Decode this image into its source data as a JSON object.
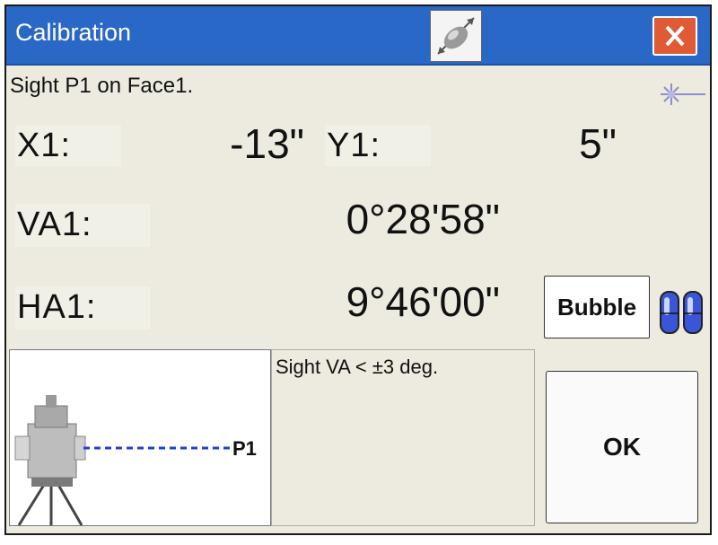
{
  "window": {
    "title": "Calibration"
  },
  "instruction": "Sight P1 on Face1.",
  "measurements": [
    {
      "label": "X1:",
      "value": "-13\""
    },
    {
      "label": "Y1:",
      "value": "5\""
    },
    {
      "label": "VA1:",
      "value": "0°28'58\""
    },
    {
      "label": "HA1:",
      "value": "9°46'00\""
    }
  ],
  "buttons": {
    "bubble": "Bubble",
    "ok": "OK"
  },
  "diagram": {
    "target_label": "P1"
  },
  "hint": "Sight VA < ±3 deg.",
  "colors": {
    "titlebar": "#2a68c8",
    "close": "#e05a35",
    "sight_line": "#1f3fd6"
  },
  "icons": [
    "calibration-icon",
    "close-icon",
    "laser-icon",
    "level-vial-icon",
    "total-station-icon"
  ]
}
